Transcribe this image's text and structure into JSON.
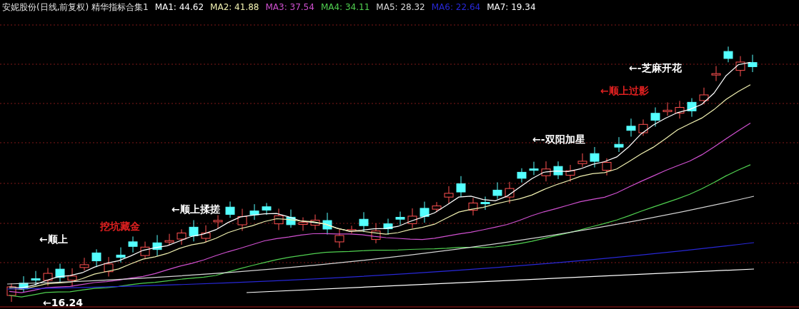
{
  "title": "安妮股份(日线,前复权) 精华指标合集1",
  "indicators": [
    {
      "label": "MA1: 44.62",
      "color": "#ffffff"
    },
    {
      "label": "MA2: 41.88",
      "color": "#f0f0b0"
    },
    {
      "label": "MA3: 37.54",
      "color": "#d050d0"
    },
    {
      "label": "MA4: 34.11",
      "color": "#50d050"
    },
    {
      "label": "MA5: 28.32",
      "color": "#d8d8d8"
    },
    {
      "label": "MA6: 22.64",
      "color": "#2828d8"
    },
    {
      "label": "MA7: 19.34",
      "color": "#ffffff"
    }
  ],
  "annotations": [
    {
      "text": "←顺上",
      "color": "#ffffff"
    },
    {
      "text": "←顺上揉搓",
      "color": "#ffffff"
    },
    {
      "text": "挖坑藏金",
      "color": "#e02020"
    },
    {
      "text": "←-双阳加星",
      "color": "#ffffff"
    },
    {
      "text": "←顺上过影",
      "color": "#e02020"
    },
    {
      "text": "←-芝麻开花",
      "color": "#ffffff"
    },
    {
      "text": "←16.24",
      "color": "#ffffff"
    }
  ]
}
